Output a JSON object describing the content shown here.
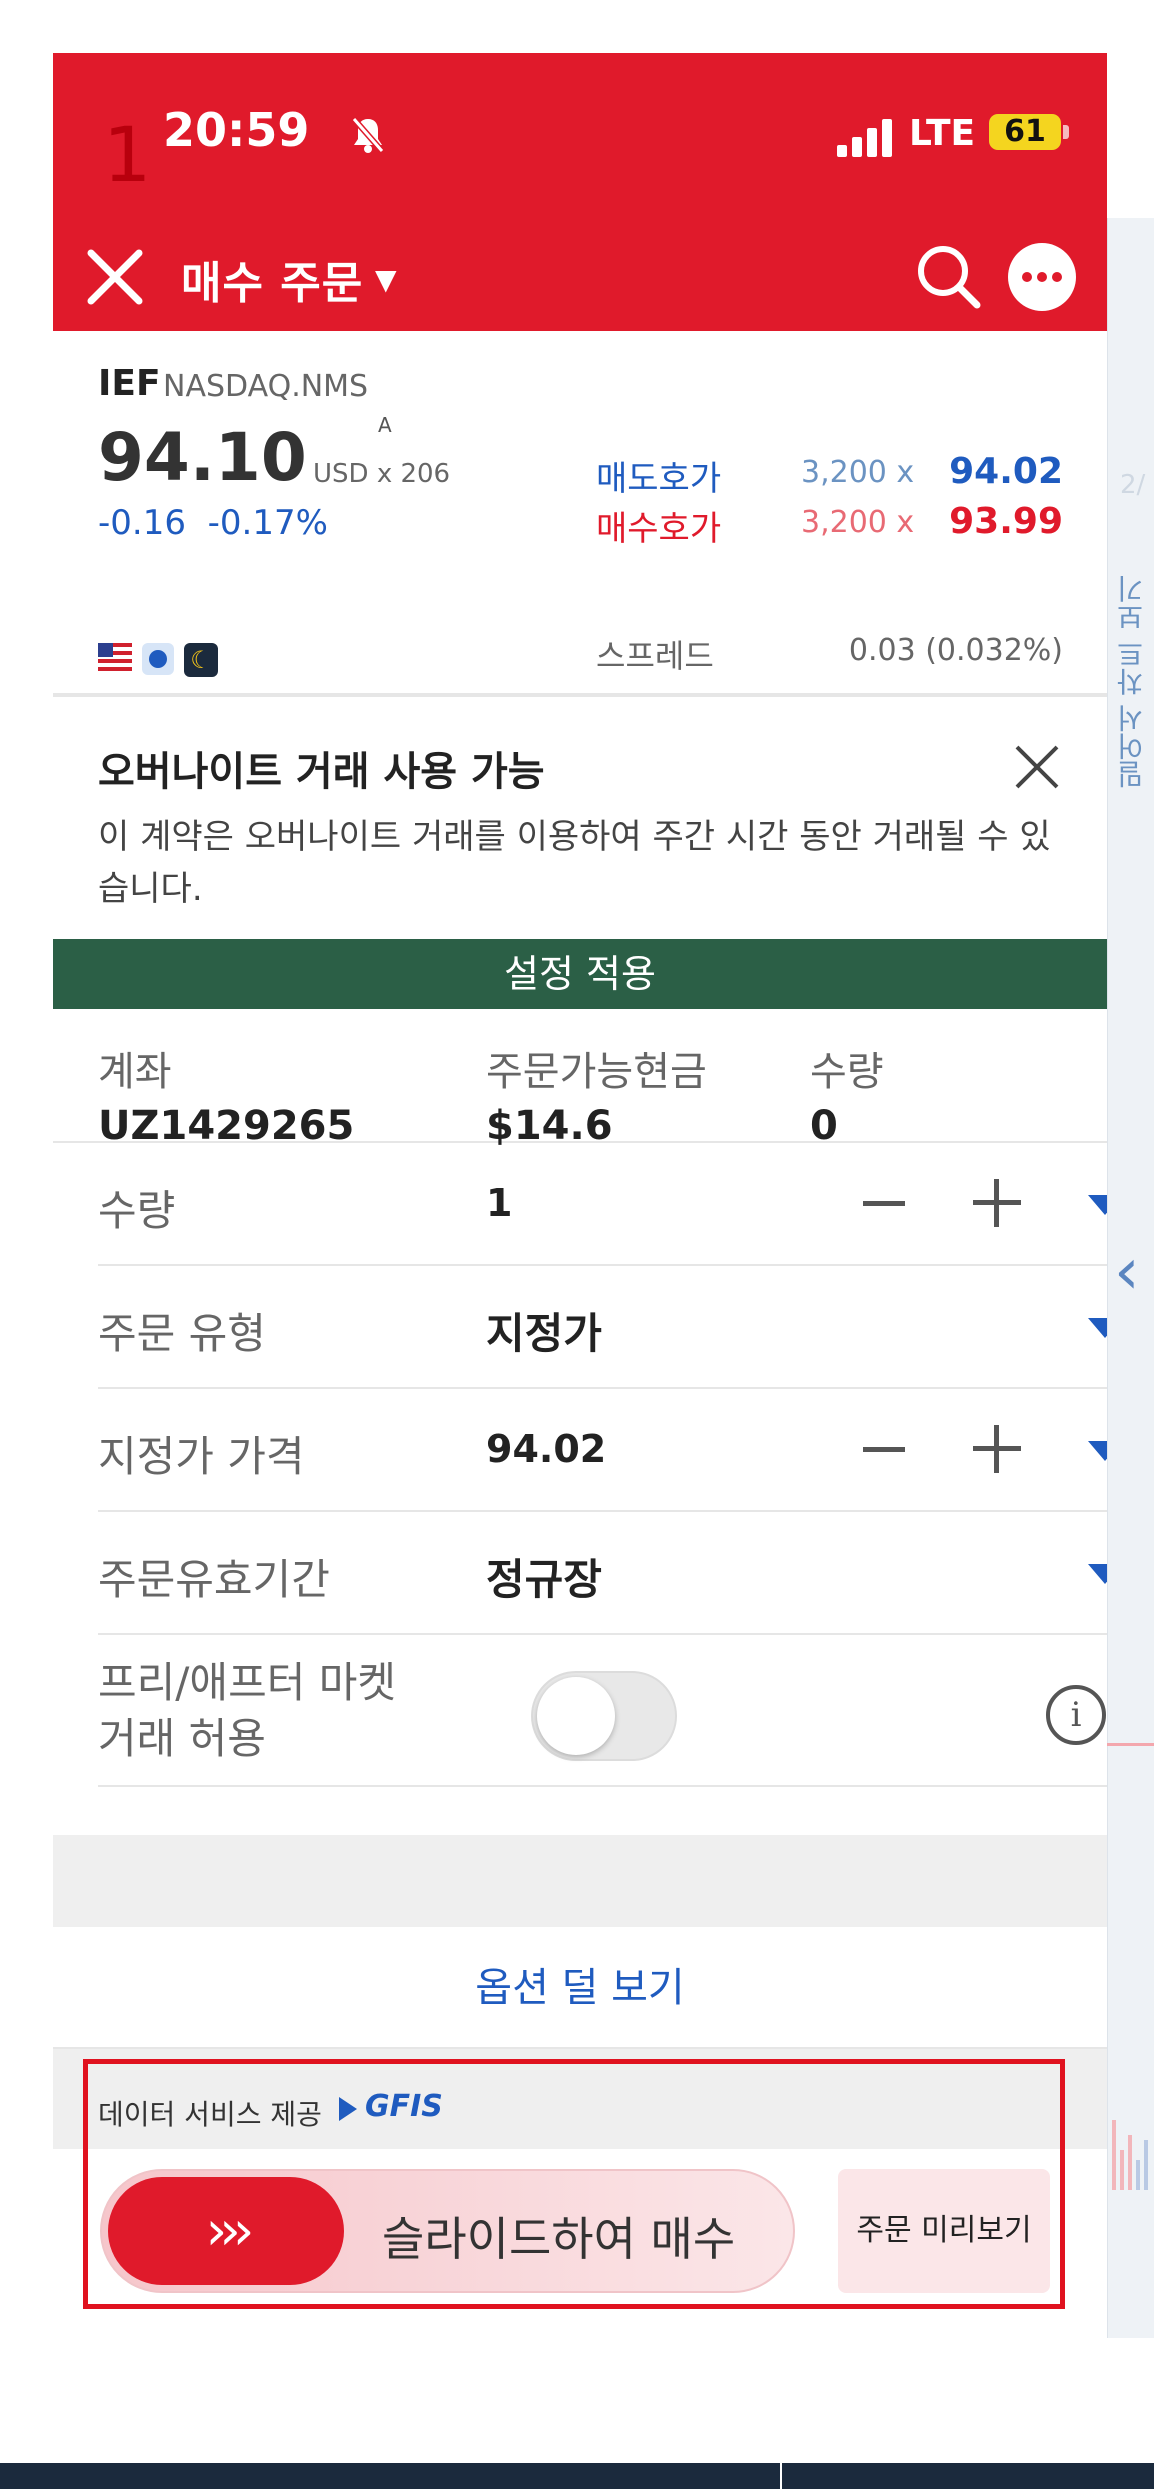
{
  "status_bar": {
    "time": "20:59",
    "network": "LTE",
    "battery": "61",
    "marker": "1"
  },
  "header": {
    "title": "매수 주문"
  },
  "quote": {
    "symbol": "IEF",
    "exchange": "NASDAQ.NMS",
    "badge": "A",
    "price": "94.10",
    "currency_size": "USD x 206",
    "change": "-0.16",
    "change_pct": "-0.17%",
    "ask_label": "매도호가",
    "ask_qty": "3,200 x",
    "ask_price": "94.02",
    "bid_label": "매수호가",
    "bid_qty": "3,200 x",
    "bid_price": "93.99",
    "spread_label": "스프레드",
    "spread_value": "0.03 (0.032%)"
  },
  "notice": {
    "title": "오버나이트 거래 사용 가능",
    "body": "이 계약은 오버나이트 거래를 이용하여 주간 시간 동안 거래될 수 있습니다."
  },
  "apply_settings": "설정 적용",
  "account": {
    "account_header": "계좌",
    "account_value": "UZ1429265",
    "cash_header": "주문가능현금",
    "cash_value": "$14.6",
    "qty_header": "수량",
    "qty_value": "0"
  },
  "form": {
    "quantity_label": "수량",
    "quantity_value": "1",
    "order_type_label": "주문 유형",
    "order_type_value": "지정가",
    "limit_price_label": "지정가 가격",
    "limit_price_value": "94.02",
    "tif_label": "주문유효기간",
    "tif_value": "정규장",
    "extended_label_line1": "프리/애프터 마켓",
    "extended_label_line2": "거래 허용",
    "extended_enabled": false
  },
  "show_less_options": "옵션 덜 보기",
  "data_provider": {
    "label": "데이터 서비스 제공",
    "brand": "GFIS"
  },
  "slider": {
    "arrows": "›››",
    "label": "슬라이드하여 매수"
  },
  "preview_button": "주문 미리보기",
  "side_panel": {
    "label": "밀어서 차트 보기"
  },
  "colors": {
    "brand_red": "#e01a2b",
    "link_blue": "#1f5bbf",
    "apply_green": "#2b5f46"
  }
}
